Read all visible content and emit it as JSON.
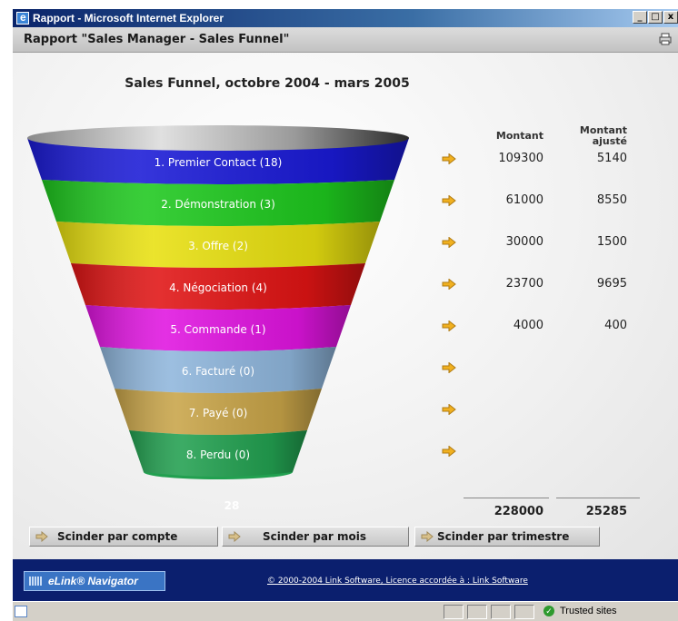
{
  "window": {
    "title": "Rapport - Microsoft Internet Explorer",
    "controls": [
      "_",
      "□",
      "x"
    ]
  },
  "header": {
    "title": "Rapport \"Sales Manager - Sales Funnel\"",
    "print_icon": "printer-icon"
  },
  "chart": {
    "title": "Sales Funnel, octobre 2004 - mars 2005",
    "col_montant": "Montant",
    "col_montant_ajuste_1": "Montant",
    "col_montant_ajuste_2": "ajusté",
    "funnel_total": "28"
  },
  "chart_data": {
    "type": "table",
    "title": "Sales Funnel, octobre 2004 - mars 2005",
    "columns": [
      "Montant",
      "Montant ajusté"
    ],
    "stages": [
      {
        "label": "1. Premier Contact (18)",
        "count": 18,
        "montant": "109300",
        "montant_ajuste": "5140",
        "color": "#1a1ad6"
      },
      {
        "label": "2. Démonstration (3)",
        "count": 3,
        "montant": "61000",
        "montant_ajuste": "8550",
        "color": "#1ec81e"
      },
      {
        "label": "3. Offre (2)",
        "count": 2,
        "montant": "30000",
        "montant_ajuste": "1500",
        "color": "#e8e010"
      },
      {
        "label": "4. Négociation (4)",
        "count": 4,
        "montant": "23700",
        "montant_ajuste": "9695",
        "color": "#e01414"
      },
      {
        "label": "5. Commande (1)",
        "count": 1,
        "montant": "4000",
        "montant_ajuste": "400",
        "color": "#e014e0"
      },
      {
        "label": "6. Facturé  (0)",
        "count": 0,
        "montant": "",
        "montant_ajuste": "",
        "color": "#8fb6dc"
      },
      {
        "label": "7. Payé (0)",
        "count": 0,
        "montant": "",
        "montant_ajuste": "",
        "color": "#c8a448"
      },
      {
        "label": "8. Perdu (0)",
        "count": 0,
        "montant": "",
        "montant_ajuste": "",
        "color": "#22a050"
      }
    ],
    "totals": {
      "montant": "228000",
      "montant_ajuste": "25285"
    }
  },
  "buttons": [
    {
      "label": "Scinder par compte"
    },
    {
      "label": "Scinder par mois"
    },
    {
      "label": "Scinder par trimestre"
    }
  ],
  "footer": {
    "brand": "eLink® Navigator",
    "copyright": "© 2000-2004 Link Software, Licence accordée à : Link Software"
  },
  "statusbar": {
    "zone": "Trusted sites"
  },
  "colors": {
    "arrow": "#f0b020",
    "footer_bg": "#0b1f6e"
  }
}
